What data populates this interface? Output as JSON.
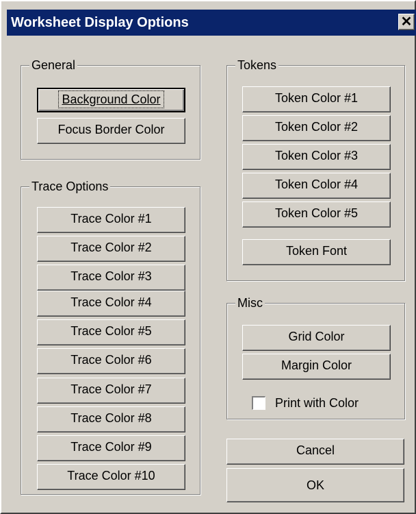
{
  "window": {
    "title": "Worksheet Display Options",
    "close_glyph": "✕"
  },
  "general": {
    "label": "General",
    "buttons": [
      "Background Color",
      "Focus Border Color"
    ]
  },
  "trace": {
    "label": "Trace Options",
    "buttons": [
      "Trace Color #1",
      "Trace Color #2",
      "Trace Color #3",
      "Trace Color #4",
      "Trace Color #5",
      "Trace Color #6",
      "Trace Color #7",
      "Trace Color #8",
      "Trace Color #9",
      "Trace Color #10"
    ]
  },
  "tokens": {
    "label": "Tokens",
    "buttons": [
      "Token Color #1",
      "Token Color #2",
      "Token Color #3",
      "Token Color #4",
      "Token Color #5"
    ],
    "font_button": "Token Font"
  },
  "misc": {
    "label": "Misc",
    "buttons": [
      "Grid Color",
      "Margin Color"
    ],
    "print_with_color": {
      "label": "Print with Color",
      "checked": false
    }
  },
  "actions": {
    "cancel": "Cancel",
    "ok": "OK"
  }
}
